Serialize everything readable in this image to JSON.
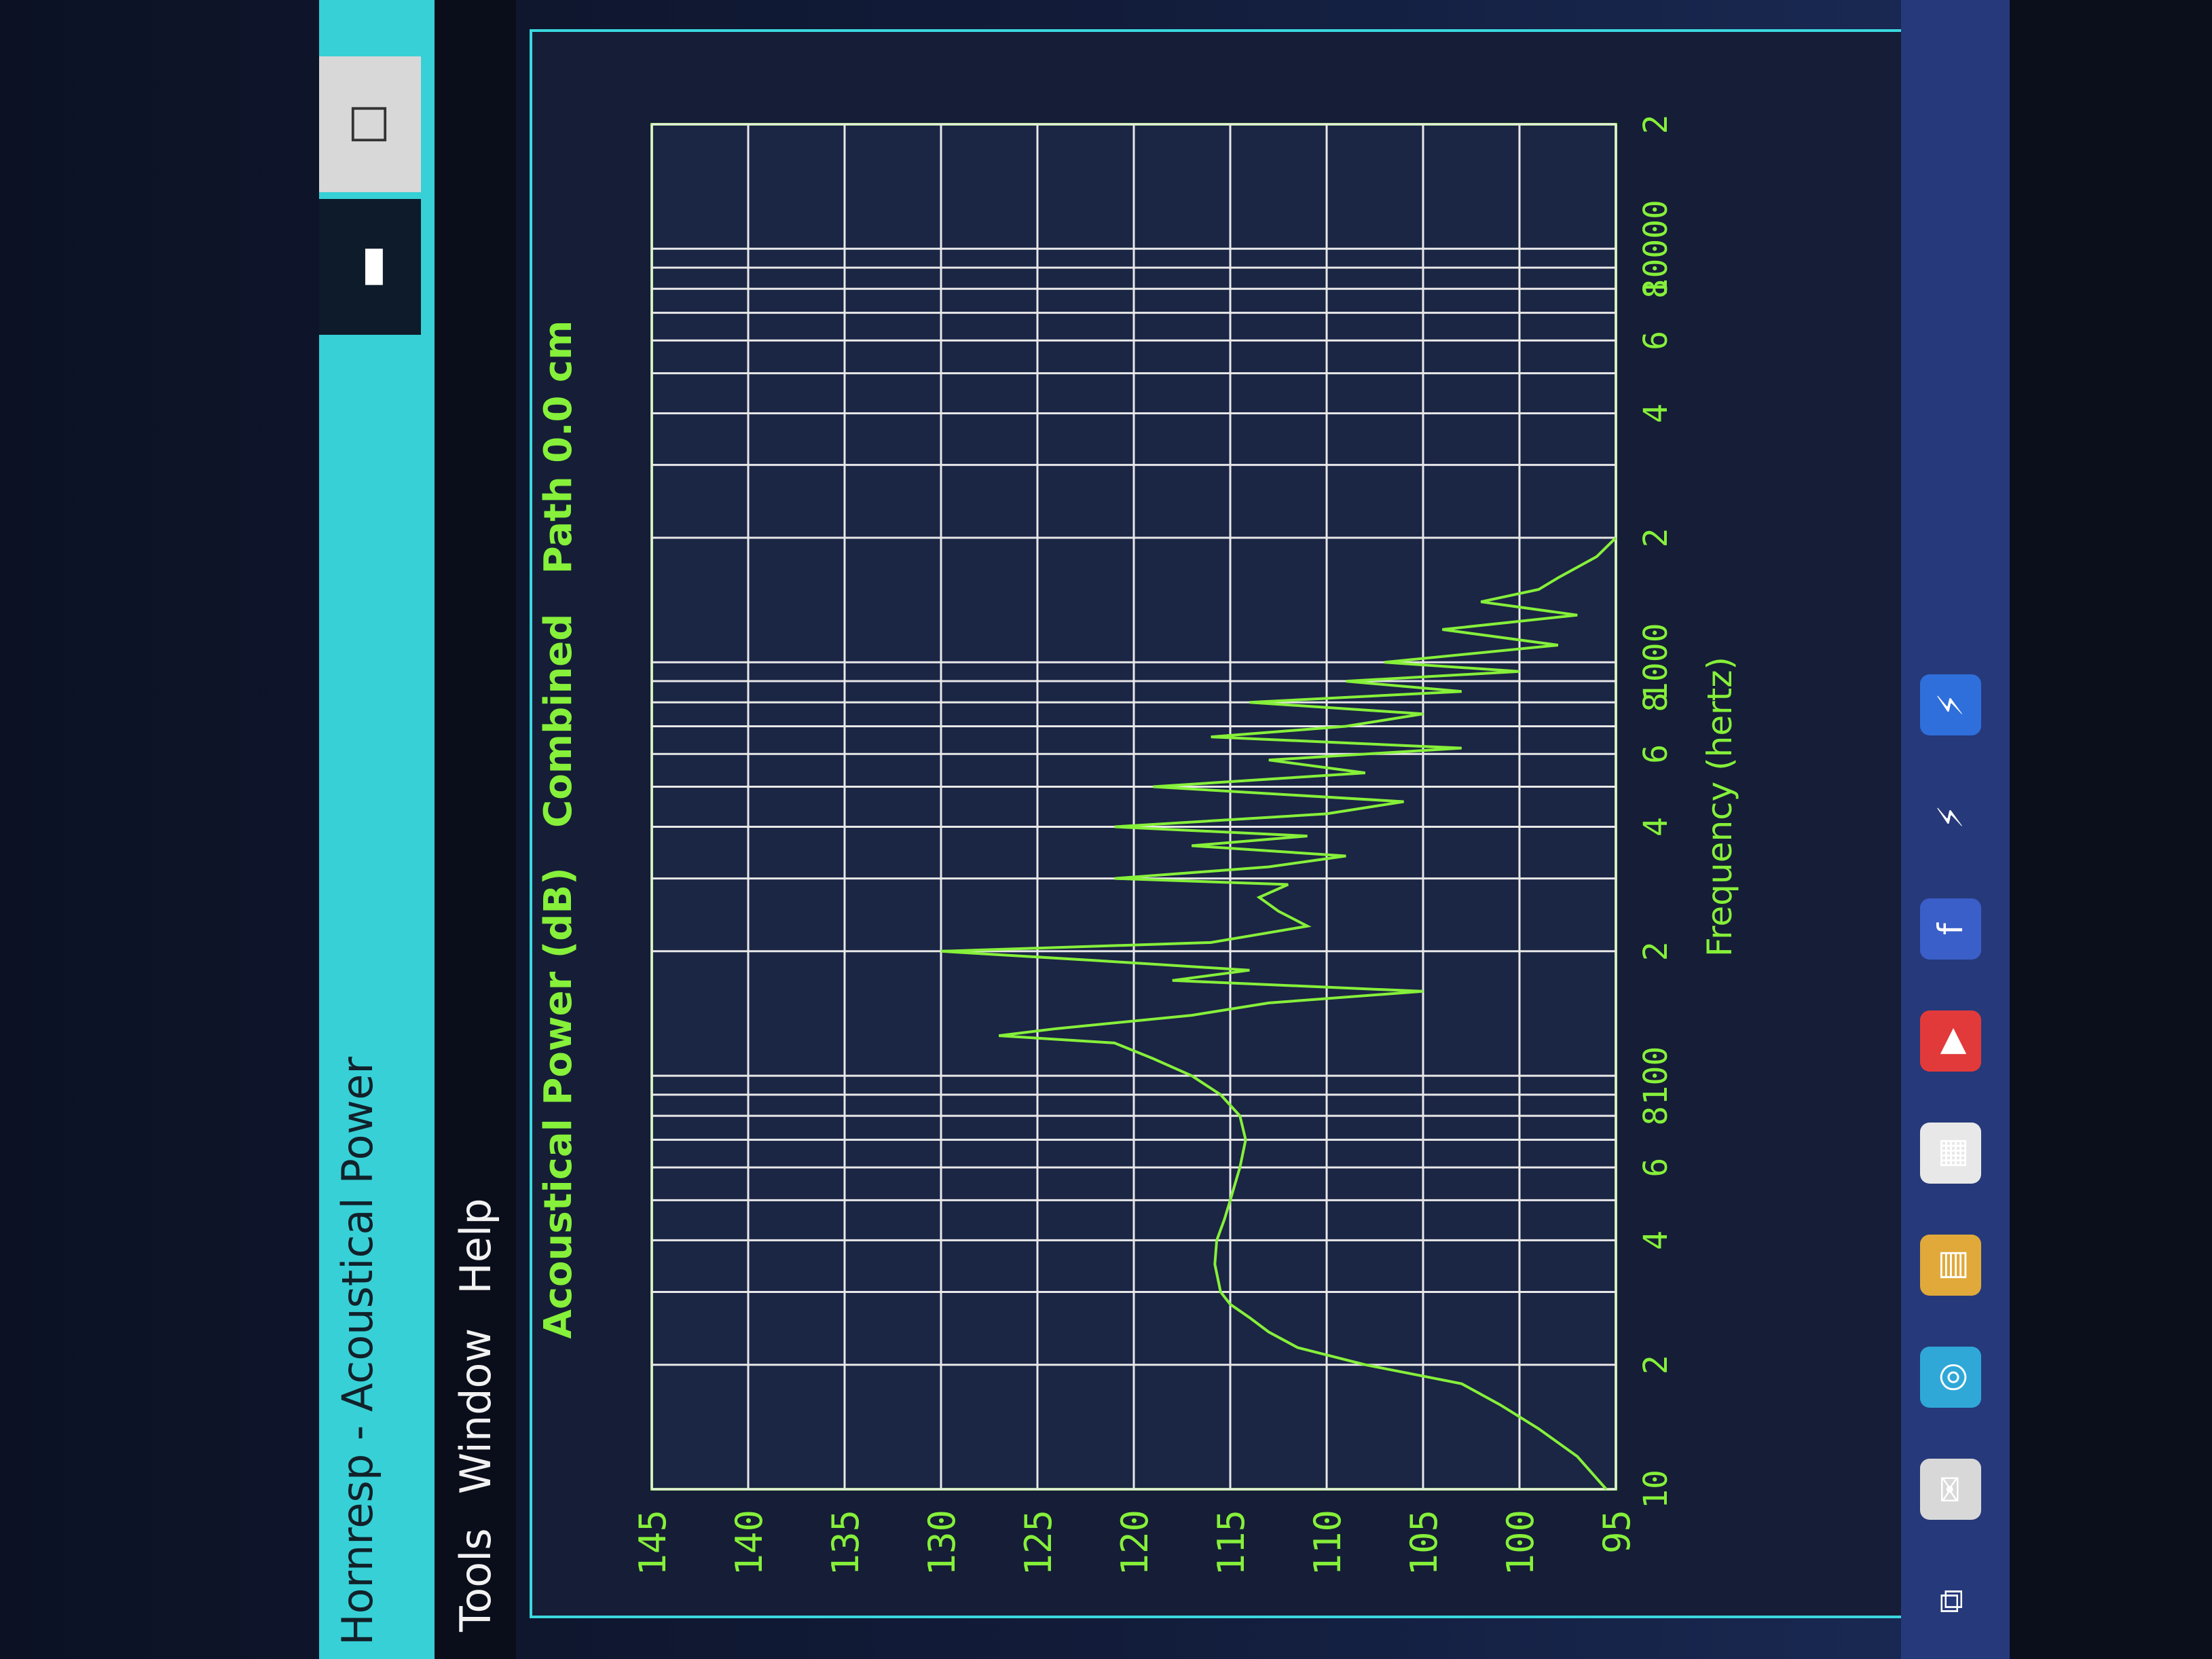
{
  "window": {
    "title": "Hornresp - Acoustical Power",
    "minimize_icon": "minimize-icon",
    "maximize_icon": "maximize-icon"
  },
  "menu": [
    "Tools",
    "Window",
    "Help"
  ],
  "chart_data": {
    "type": "line",
    "title": "Acoustical Power (dB)   Combined   Path 0.0 cm",
    "xlabel": "Frequency (hertz)",
    "ylabel": "",
    "x_scale": "log",
    "xlim": [
      10,
      20000
    ],
    "ylim": [
      95,
      145
    ],
    "y_ticks": [
      95,
      100,
      105,
      110,
      115,
      120,
      125,
      130,
      135,
      140,
      145
    ],
    "x_tick_labels": [
      {
        "x": 10,
        "label": "10"
      },
      {
        "x": 20,
        "label": "2"
      },
      {
        "x": 40,
        "label": "4"
      },
      {
        "x": 60,
        "label": "6"
      },
      {
        "x": 80,
        "label": "8"
      },
      {
        "x": 100,
        "label": "100"
      },
      {
        "x": 200,
        "label": "2"
      },
      {
        "x": 400,
        "label": "4"
      },
      {
        "x": 600,
        "label": "6"
      },
      {
        "x": 800,
        "label": "8"
      },
      {
        "x": 1000,
        "label": "1000"
      },
      {
        "x": 2000,
        "label": "2"
      },
      {
        "x": 4000,
        "label": "4"
      },
      {
        "x": 6000,
        "label": "6"
      },
      {
        "x": 8000,
        "label": "8"
      },
      {
        "x": 10000,
        "label": "10000"
      },
      {
        "x": 20000,
        "label": "2"
      }
    ],
    "grid": true,
    "series": [
      {
        "color": "#86f03a",
        "x": [
          10,
          12,
          14,
          16,
          18,
          20,
          22,
          24,
          26,
          28,
          30,
          35,
          40,
          45,
          50,
          60,
          70,
          80,
          90,
          100,
          110,
          120,
          125,
          130,
          140,
          150,
          160,
          170,
          180,
          190,
          200,
          210,
          230,
          250,
          270,
          290,
          300,
          320,
          340,
          360,
          380,
          400,
          430,
          460,
          500,
          540,
          580,
          620,
          660,
          700,
          750,
          800,
          850,
          900,
          950,
          1000,
          1100,
          1200,
          1300,
          1400,
          1500,
          1600,
          1800,
          2000
        ],
        "y": [
          95.5,
          97,
          99,
          101,
          103,
          108,
          111.5,
          113,
          114,
          115,
          115.5,
          115.8,
          115.7,
          115.3,
          115,
          114.5,
          114.2,
          114.5,
          115.5,
          117,
          119,
          121,
          127,
          124,
          117,
          113,
          105,
          118,
          114,
          122,
          130,
          116,
          111,
          112.5,
          113.5,
          112,
          121,
          113,
          109,
          117,
          111,
          121,
          110,
          106,
          119,
          108,
          113,
          103,
          116,
          109,
          105,
          114,
          103,
          109,
          100,
          107,
          98,
          104,
          97,
          102,
          99,
          98,
          96,
          95
        ]
      }
    ]
  },
  "taskbar_icons": [
    "task-view-icon",
    "mail-icon",
    "edge-icon",
    "file-explorer-icon",
    "store-icon",
    "youtube-icon",
    "facebook-icon",
    "lightning-icon",
    "lightning-app-icon"
  ]
}
